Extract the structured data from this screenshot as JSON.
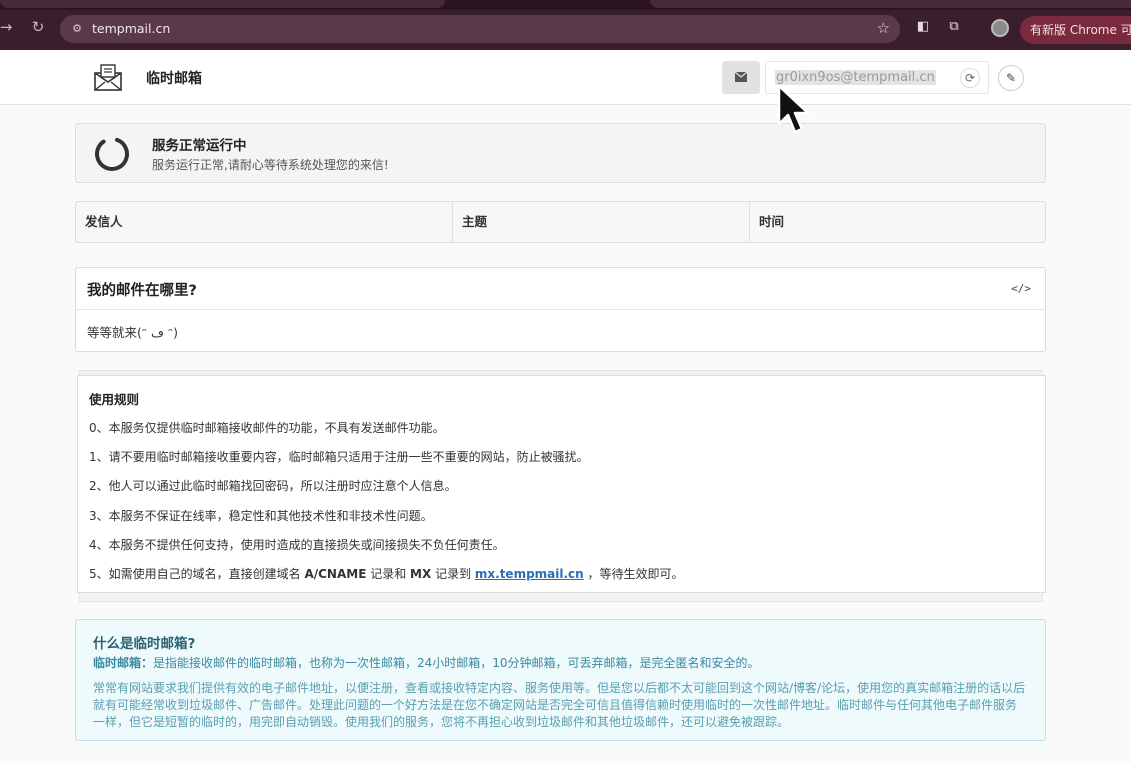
{
  "browser": {
    "url": "tempmail.cn",
    "update_label": "有新版 Chrome 可用"
  },
  "header": {
    "site_name": "临时邮箱",
    "email": "gr0ixn9os@tempmail.cn"
  },
  "status": {
    "title": "服务正常运行中",
    "desc": "服务运行正常,请耐心等待系统处理您的来信!"
  },
  "table": {
    "columns": [
      "发信人",
      "主题",
      "时间"
    ]
  },
  "where": {
    "title": "我的邮件在哪里?",
    "body": "等等就来(ᵔ ڡ ᵔ)"
  },
  "rules": {
    "title": "使用规则",
    "items": [
      "0、本服务仅提供临时邮箱接收邮件的功能，不具有发送邮件功能。",
      "1、请不要用临时邮箱接收重要内容，临时邮箱只适用于注册一些不重要的网站，防止被骚扰。",
      "2、他人可以通过此临时邮箱找回密码，所以注册时应注意个人信息。",
      "3、本服务不保证在线率，稳定性和其他技术性和非技术性问题。",
      "4、本服务不提供任何支持，使用时造成的直接损失或间接损失不负任何责任。"
    ],
    "item5_prefix": "5、如需使用自己的域名，直接创建域名 ",
    "item5_bold1": "A/CNAME",
    "item5_mid1": " 记录和 ",
    "item5_bold2": "MX",
    "item5_mid2": " 记录到 ",
    "item5_link": "mx.tempmail.cn",
    "item5_suffix": " ，等待生效即可。"
  },
  "info": {
    "title": "什么是临时邮箱?",
    "def_label": "临时邮箱：",
    "def_text": "是指能接收邮件的临时邮箱，也称为一次性邮箱，24小时邮箱，10分钟邮箱，可丢弃邮箱，是完全匿名和安全的。",
    "body": "常常有网站要求我们提供有效的电子邮件地址，以便注册，查看或接收特定内容、服务使用等。但是您以后都不太可能回到这个网站/博客/论坛，使用您的真实邮箱注册的话以后就有可能经常收到垃圾邮件、广告邮件。处理此问题的一个好方法是在您不确定网站是否完全可信且值得信赖时使用临时的一次性邮件地址。临时邮件与任何其他电子邮件服务一样，但它是短暂的临时的，用完即自动销毁。使用我们的服务，您将不再担心收到垃圾邮件和其他垃圾邮件，还可以避免被跟踪。"
  }
}
